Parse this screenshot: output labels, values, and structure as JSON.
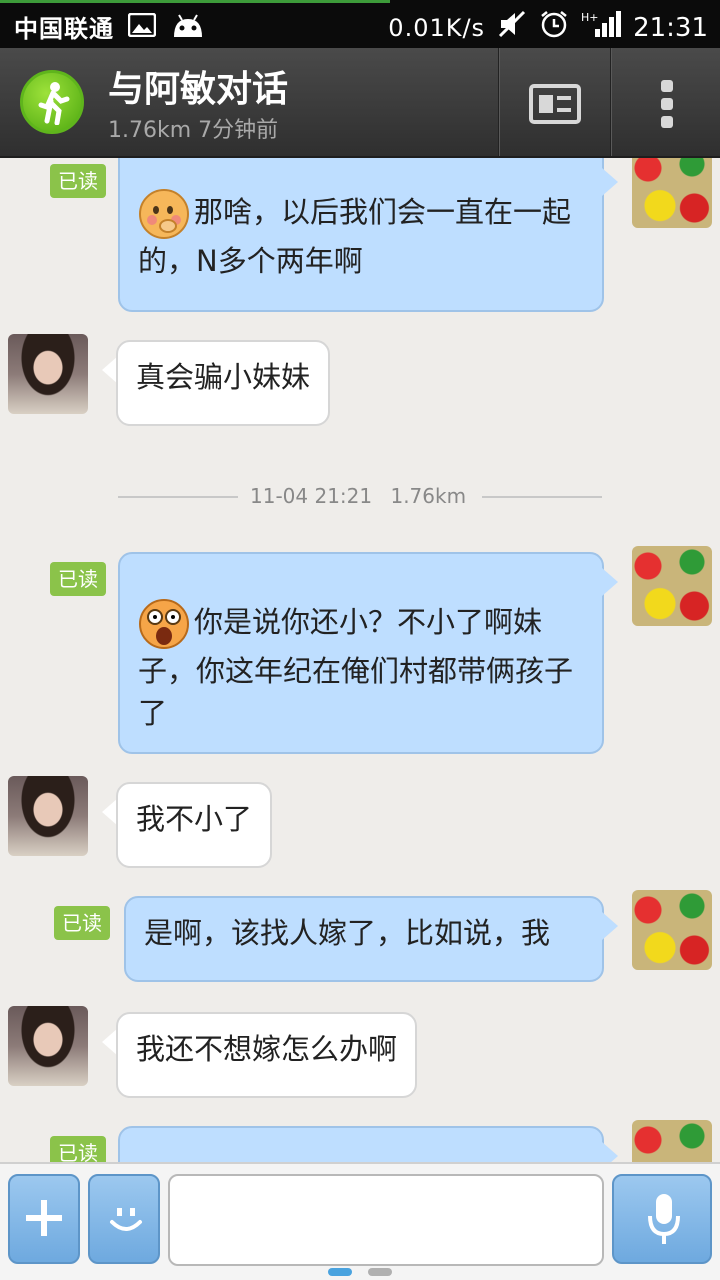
{
  "status_bar": {
    "carrier": "中国联通",
    "net_speed": "0.01K/s",
    "network_type": "H+",
    "time": "21:31"
  },
  "header": {
    "title": "与阿敏对话",
    "distance": "1.76km",
    "last_seen": "7分钟前",
    "icons": [
      "walking-person-icon",
      "contact-card-icon",
      "more-vertical-icon"
    ]
  },
  "chat": {
    "read_label": "已读",
    "divider": {
      "date_time": "11-04 21:21",
      "distance": "1.76km"
    },
    "messages": [
      {
        "sender": "self",
        "emoji": "shy-face-emoji",
        "text": "那啥，以后我们会一直在一起的，N多个两年啊",
        "read": true
      },
      {
        "sender": "other",
        "text": "真会骗小妹妹"
      },
      {
        "sender": "self",
        "emoji": "shocked-face-emoji",
        "text": "你是说你还小？不小了啊妹子，你这年纪在俺们村都带俩孩子了",
        "read": true
      },
      {
        "sender": "other",
        "text": "我不小了"
      },
      {
        "sender": "self",
        "text": "是啊，该找人嫁了，比如说，我",
        "read": true
      },
      {
        "sender": "other",
        "text": "我还不想嫁怎么办啊"
      },
      {
        "sender": "self",
        "text": "",
        "read": true
      }
    ]
  },
  "input_bar": {
    "text_value": "",
    "icons": [
      "plus-icon",
      "smiley-icon",
      "microphone-icon"
    ]
  },
  "colors": {
    "self_bubble": "#bedeff",
    "other_bubble": "#ffffff",
    "read_badge": "#8bc34a",
    "header_bg": "#3a3a3a",
    "input_buttons": "#7fb3e3"
  }
}
